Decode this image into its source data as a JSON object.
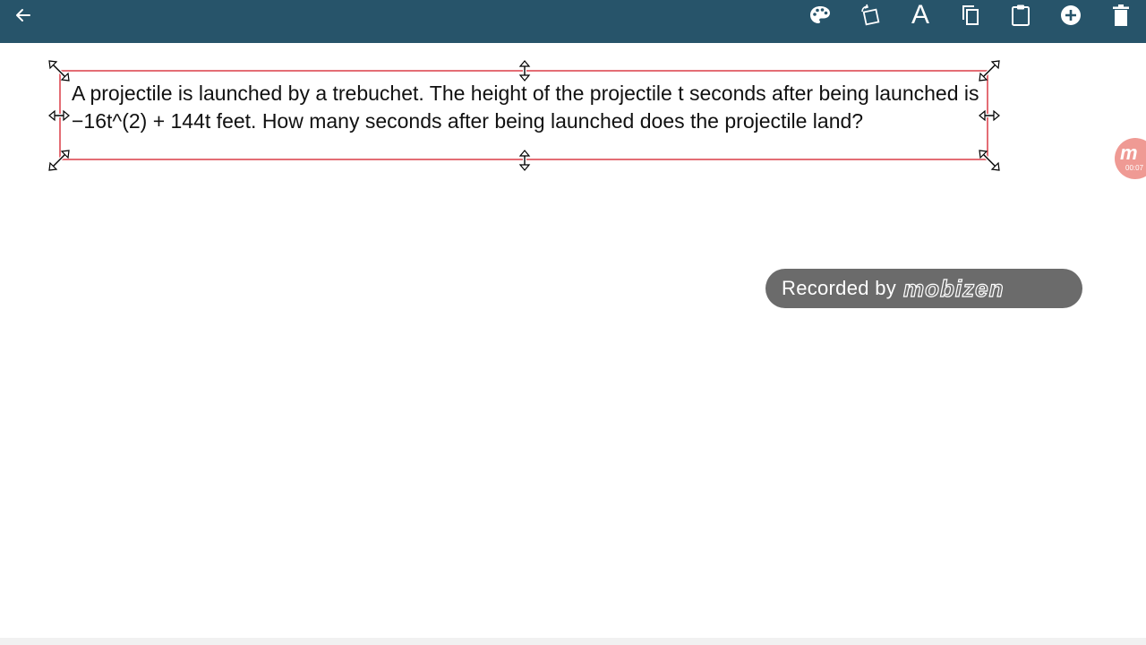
{
  "toolbar": {
    "background": "#27546a",
    "back_icon": "arrow-left-icon",
    "actions": [
      {
        "name": "color-palette",
        "icon": "palette-icon"
      },
      {
        "name": "rotate",
        "icon": "rotate-icon"
      },
      {
        "name": "text-style",
        "icon": "text-icon",
        "label": "A"
      },
      {
        "name": "copy",
        "icon": "copy-icon"
      },
      {
        "name": "paste",
        "icon": "clipboard-icon"
      },
      {
        "name": "add",
        "icon": "add-circle-icon"
      },
      {
        "name": "delete",
        "icon": "trash-icon"
      }
    ]
  },
  "textbox": {
    "text": "A projectile is launched by a trebuchet. The height of the projectile t seconds after being launched is −16t^(2) + 144t feet. How many seconds after being launched does the projectile land?",
    "border_color": "#e46d75"
  },
  "watermark": {
    "text": "Recorded by",
    "logo_text": "mobizen"
  },
  "recorder": {
    "letter": "m",
    "time": "00:07",
    "color": "#ef9a94"
  }
}
